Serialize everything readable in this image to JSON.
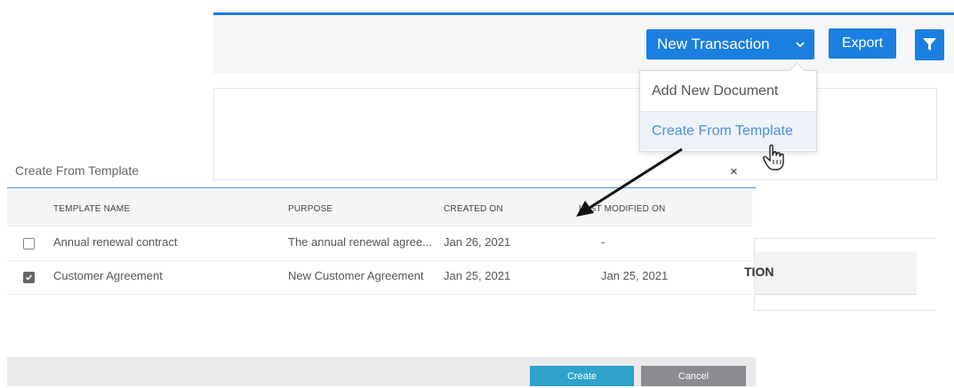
{
  "toolbar": {
    "new_transaction_label": "New Transaction",
    "export_label": "Export"
  },
  "dropdown": {
    "items": [
      {
        "label": "Add New Document"
      },
      {
        "label": "Create From Template"
      }
    ]
  },
  "background": {
    "column_fragment": "TION"
  },
  "modal": {
    "title": "Create From Template",
    "close_label": "×",
    "columns": [
      "TEMPLATE NAME",
      "PURPOSE",
      "CREATED ON",
      "LAST MODIFIED ON"
    ],
    "rows": [
      {
        "checked": false,
        "name": "Annual renewal contract",
        "purpose": "The annual renewal agree...",
        "created": "Jan 26, 2021",
        "modified": "-"
      },
      {
        "checked": true,
        "name": "Customer Agreement",
        "purpose": "New Customer Agreement",
        "created": "Jan 25, 2021",
        "modified": "Jan 25, 2021"
      }
    ],
    "create_label": "Create",
    "cancel_label": "Cancel"
  },
  "colors": {
    "accent": "#1a7fe0",
    "create_button": "#2fa2c9",
    "cancel_button": "#8a8c90"
  }
}
